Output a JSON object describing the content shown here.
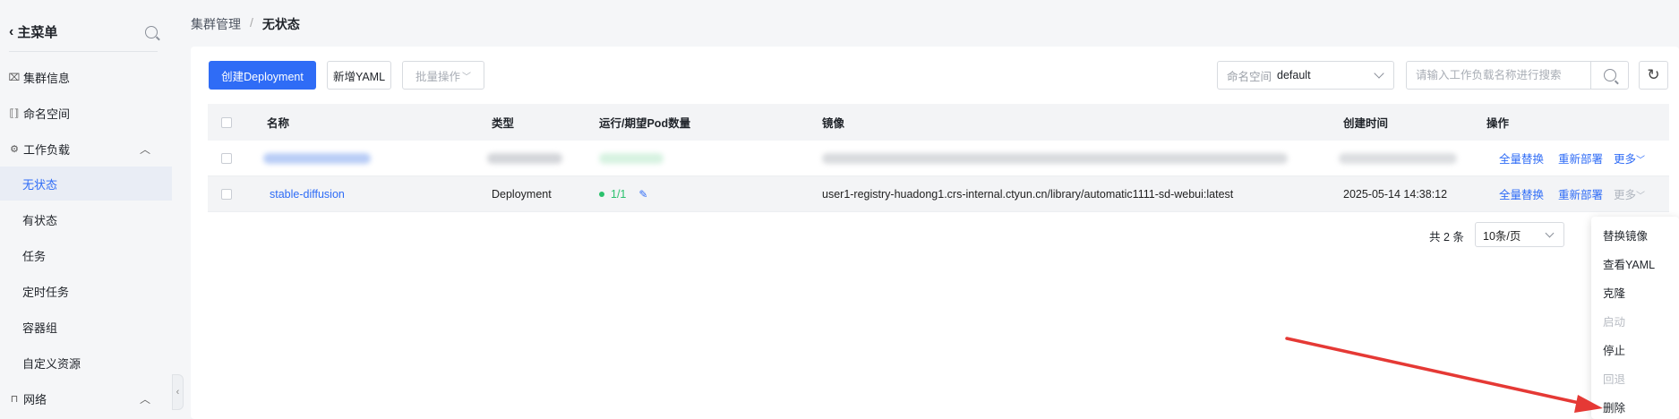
{
  "sidebar": {
    "title": "主菜单",
    "items": [
      {
        "label": "集群信息",
        "icon": "cluster-icon"
      },
      {
        "label": "命名空间",
        "icon": "namespace-icon"
      },
      {
        "label": "工作负载",
        "icon": "workload-icon",
        "expanded": true
      },
      {
        "label": "无状态",
        "active": true
      },
      {
        "label": "有状态"
      },
      {
        "label": "任务"
      },
      {
        "label": "定时任务"
      },
      {
        "label": "容器组"
      },
      {
        "label": "自定义资源"
      },
      {
        "label": "网络",
        "icon": "network-icon",
        "expanded": true
      }
    ]
  },
  "breadcrumb": {
    "parent": "集群管理",
    "separator": "/",
    "current": "无状态"
  },
  "toolbar": {
    "create_label": "创建Deployment",
    "yaml_label": "新增YAML",
    "batch_label": "批量操作",
    "namespace_label": "命名空间",
    "namespace_value": "default",
    "search_placeholder": "请输入工作负载名称进行搜索"
  },
  "table": {
    "headers": [
      "名称",
      "类型",
      "运行/期望Pod数量",
      "镜像",
      "创建时间",
      "操作"
    ],
    "rows": [
      {
        "name": "stable-diffusion",
        "type": "Deployment",
        "pods": "1/1",
        "image": "user1-registry-huadong1.crs-internal.ctyun.cn/library/automatic1111-sd-webui:latest",
        "created": "2025-05-14 14:38:12"
      }
    ],
    "actions": {
      "replace_all": "全量替换",
      "redeploy": "重新部署",
      "more": "更多"
    }
  },
  "pagination": {
    "total": "共 2 条",
    "page_size": "10条/页"
  },
  "more_menu": {
    "items": [
      {
        "label": "替换镜像",
        "disabled": false
      },
      {
        "label": "查看YAML",
        "disabled": false
      },
      {
        "label": "克隆",
        "disabled": false
      },
      {
        "label": "启动",
        "disabled": true
      },
      {
        "label": "停止",
        "disabled": false
      },
      {
        "label": "回退",
        "disabled": true
      },
      {
        "label": "删除",
        "disabled": false
      }
    ]
  },
  "colors": {
    "primary": "#2f6cf6",
    "success": "#2bc16d",
    "annotation_arrow": "#e53935"
  }
}
